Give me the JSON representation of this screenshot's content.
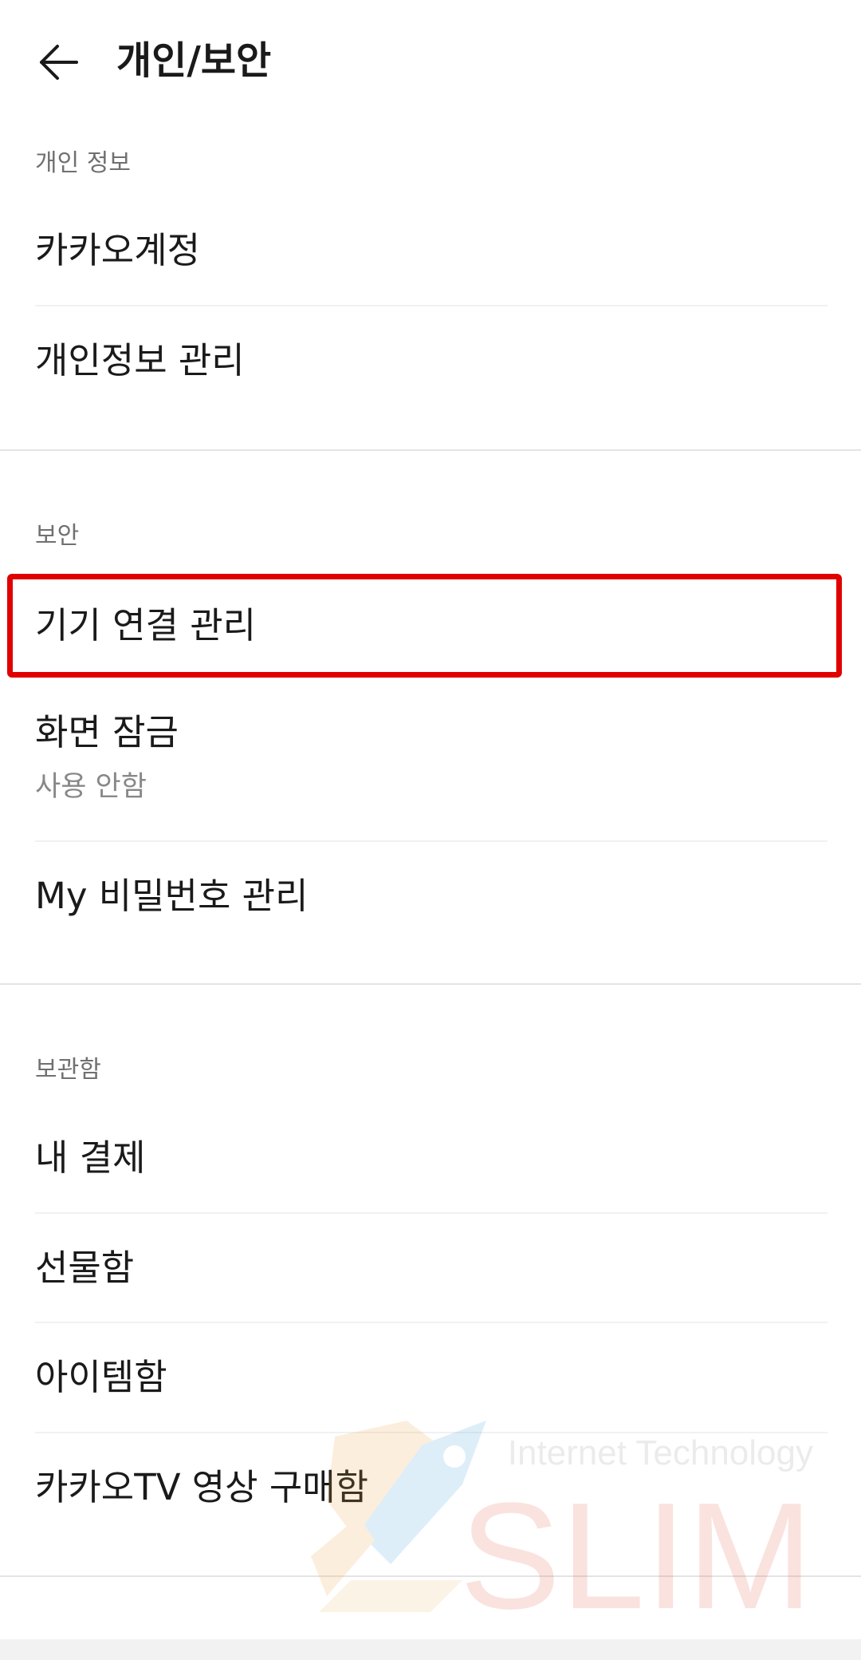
{
  "header": {
    "back_icon": "arrow-left-icon",
    "title": "개인/보안"
  },
  "sections": [
    {
      "title": "개인 정보",
      "items": [
        {
          "label": "카카오계정"
        },
        {
          "label": "개인정보 관리"
        }
      ]
    },
    {
      "title": "보안",
      "items": [
        {
          "label": "기기 연결 관리",
          "highlighted": true
        },
        {
          "label": "화면 잠금",
          "sublabel": "사용 안함"
        },
        {
          "label": "My 비밀번호 관리"
        }
      ]
    },
    {
      "title": "보관함",
      "items": [
        {
          "label": "내 결제"
        },
        {
          "label": "선물함"
        },
        {
          "label": "아이템함"
        },
        {
          "label": "카카오TV 영상 구매함"
        }
      ]
    }
  ],
  "watermark": {
    "tagline": "Internet Technology",
    "brand": "SLIM"
  },
  "colors": {
    "highlight": "#e00000",
    "text_primary": "#1a1a1a",
    "text_secondary": "#707070",
    "sublabel": "#888888"
  }
}
